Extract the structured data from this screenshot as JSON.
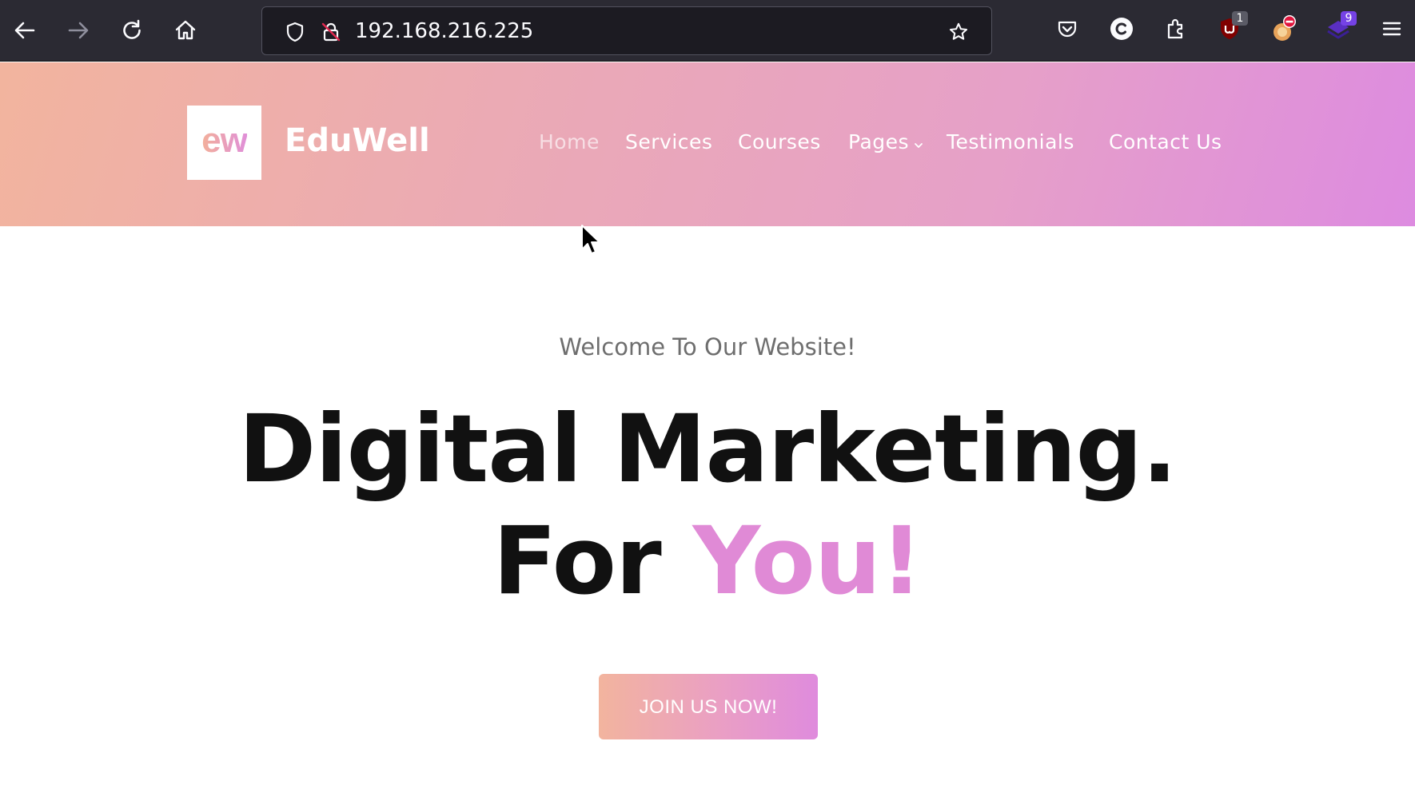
{
  "browser": {
    "url": "192.168.216.225",
    "extension_badges": {
      "ublock_count": "1",
      "extension_count": "9"
    },
    "icons": [
      "back-arrow-icon",
      "forward-arrow-icon",
      "reload-icon",
      "home-icon",
      "tracking-shield-icon",
      "insecure-lock-icon",
      "bookmark-star-icon",
      "pocket-icon",
      "c-extension-icon",
      "extensions-puzzle-icon",
      "ublock-origin-icon",
      "blocker-extension-icon",
      "purple-extension-icon",
      "hamburger-menu-icon"
    ]
  },
  "site": {
    "logo_mark": "ew",
    "brand": "EduWell",
    "nav": [
      {
        "label": "Home",
        "active": true
      },
      {
        "label": "Services",
        "active": false
      },
      {
        "label": "Courses",
        "active": false
      },
      {
        "label": "Pages",
        "active": false,
        "dropdown": true
      },
      {
        "label": "Testimonials",
        "active": false
      },
      {
        "label": "Contact Us",
        "active": false
      }
    ],
    "colors": {
      "gradient_start": "#f2b49e",
      "gradient_end": "#dd8be0",
      "accent": "#e08ad6",
      "headline": "#111111"
    }
  },
  "hero": {
    "welcome": "Welcome To Our Website!",
    "headline_line1": "Digital Marketing.",
    "headline_line2_prefix": "For ",
    "headline_line2_accent": "You!",
    "cta_label": "JOIN US NOW!"
  }
}
